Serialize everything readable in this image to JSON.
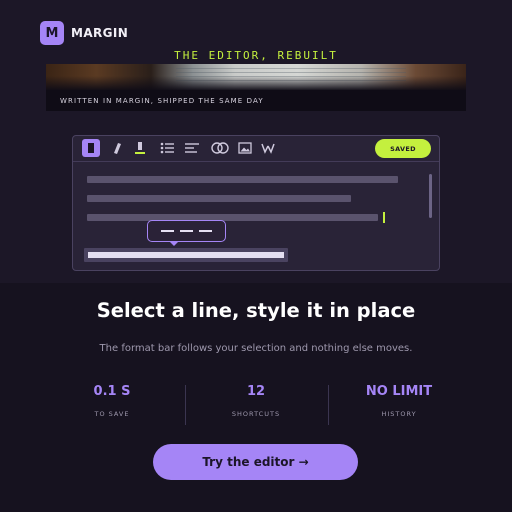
{
  "brand": {
    "mark": "M",
    "name": "MARGIN"
  },
  "hero": {
    "eyebrow": "THE EDITOR, REBUILT",
    "photo_caption": "WRITTEN IN MARGIN, SHIPPED THE SAME DAY"
  },
  "editor": {
    "toolbar": {
      "tools": [
        "block-icon",
        "pen-icon",
        "text-color-icon",
        "bullet-list-icon",
        "align-left-icon",
        "link-icon",
        "image-icon",
        "wave-icon"
      ],
      "saved_label": "SAVED"
    }
  },
  "content": {
    "headline": "Select a line, style it in place",
    "subtext": "The format bar follows your selection and nothing else moves."
  },
  "stats": [
    {
      "value": "0.1 S",
      "label": "TO SAVE"
    },
    {
      "value": "12",
      "label": "SHORTCUTS"
    },
    {
      "value": "NO LIMIT",
      "label": "HISTORY"
    }
  ],
  "cta": {
    "label": "Try the editor →"
  },
  "colors": {
    "accent": "#a585f6",
    "lime": "#c4f03e",
    "background": "#16121f"
  }
}
